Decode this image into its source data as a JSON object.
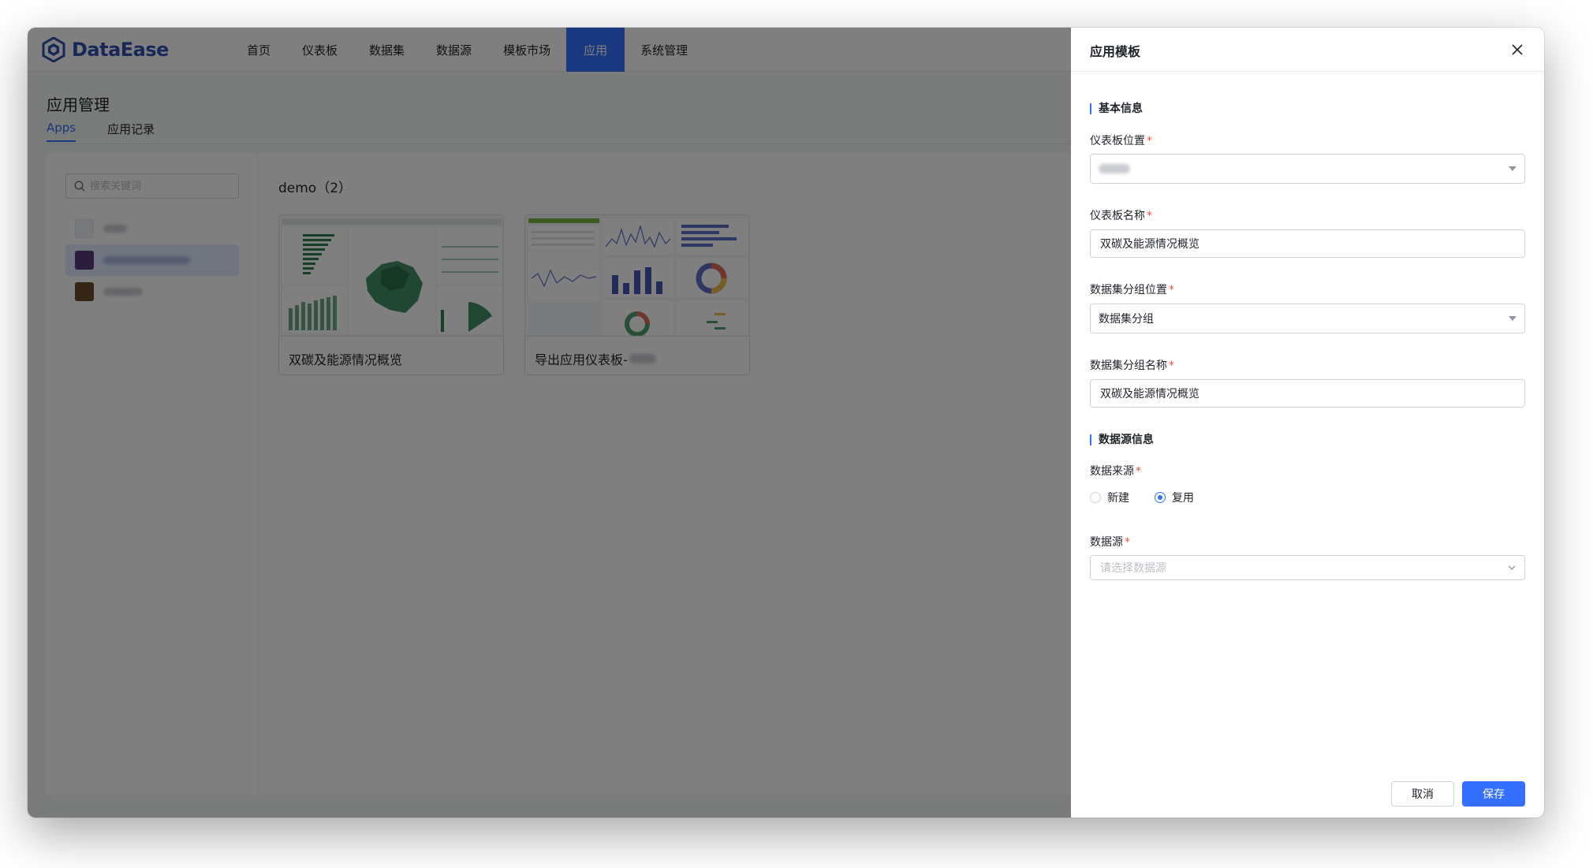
{
  "app": {
    "brand": "DataEase",
    "nav": [
      {
        "label": "首页",
        "active": false
      },
      {
        "label": "仪表板",
        "active": false
      },
      {
        "label": "数据集",
        "active": false
      },
      {
        "label": "数据源",
        "active": false
      },
      {
        "label": "模板市场",
        "active": false
      },
      {
        "label": "应用",
        "active": true
      },
      {
        "label": "系统管理",
        "active": false
      }
    ],
    "accent_color": "#3370ff",
    "brand_color": "#2f4eb1"
  },
  "page": {
    "title": "应用管理",
    "tabs": [
      {
        "label": "Apps",
        "active": true
      },
      {
        "label": "应用记录",
        "active": false
      }
    ]
  },
  "sidebar": {
    "search_placeholder": "搜索关键词"
  },
  "main": {
    "group_title": "demo（2）",
    "cards": [
      {
        "title": "双碳及能源情况概览"
      },
      {
        "title": "导出应用仪表板-"
      }
    ]
  },
  "drawer": {
    "title": "应用模板",
    "sections": {
      "basic": "基本信息",
      "datasource": "数据源信息"
    },
    "fields": {
      "dashboard_location": {
        "label": "仪表板位置"
      },
      "dashboard_name": {
        "label": "仪表板名称",
        "value": "双碳及能源情况概览"
      },
      "dataset_group_location": {
        "label": "数据集分组位置",
        "value": "数据集分组"
      },
      "dataset_group_name": {
        "label": "数据集分组名称",
        "value": "双碳及能源情况概览"
      },
      "data_origin": {
        "label": "数据来源",
        "options": [
          "新建",
          "复用"
        ],
        "selected": "复用"
      },
      "datasource": {
        "label": "数据源",
        "placeholder": "请选择数据源"
      }
    },
    "required_mark": "*",
    "buttons": {
      "cancel": "取消",
      "save": "保存"
    }
  }
}
